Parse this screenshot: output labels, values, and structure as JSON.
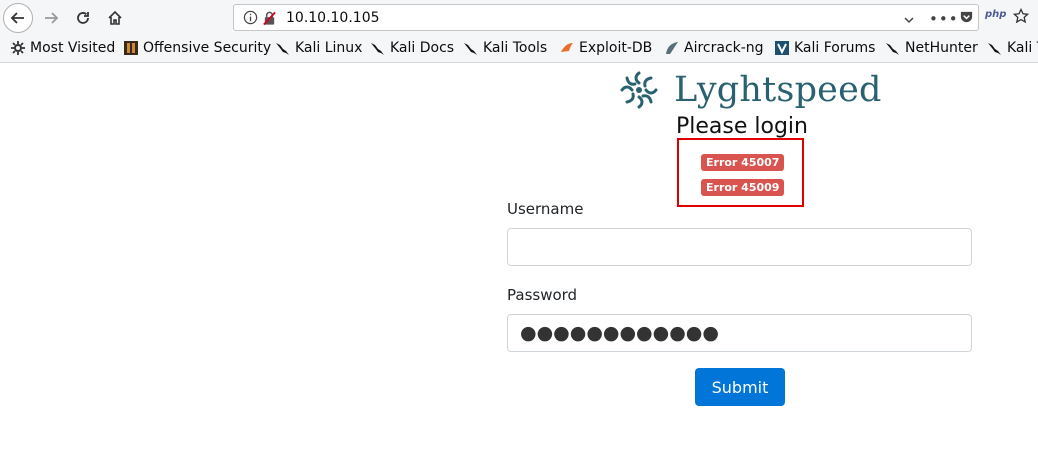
{
  "browser": {
    "url": "10.10.10.105",
    "bookmarks": [
      {
        "label": "Most Visited",
        "icon": "gear-icon"
      },
      {
        "label": "Offensive Security",
        "icon": "offsec-icon"
      },
      {
        "label": "Kali Linux",
        "icon": "kali-dragon-icon"
      },
      {
        "label": "Kali Docs",
        "icon": "kali-dragon-icon"
      },
      {
        "label": "Kali Tools",
        "icon": "kali-dragon-icon"
      },
      {
        "label": "Exploit-DB",
        "icon": "exploit-db-icon"
      },
      {
        "label": "Aircrack-ng",
        "icon": "aircrack-icon"
      },
      {
        "label": "Kali Forums",
        "icon": "kali-forums-icon"
      },
      {
        "label": "NetHunter",
        "icon": "kali-dragon-icon"
      },
      {
        "label": "Kali T",
        "icon": "kali-dragon-icon"
      }
    ]
  },
  "page": {
    "brand": "Lyghtspeed",
    "heading": "Please login",
    "errors": [
      "Error 45007",
      "Error 45009"
    ],
    "username_label": "Username",
    "username_value": "",
    "password_label": "Password",
    "password_value": "●●●●●●●●●●●●",
    "submit_label": "Submit"
  },
  "colors": {
    "brand": "#2a6170",
    "error_badge": "#d9534f",
    "highlight_box": "#e00000",
    "submit_button": "#0275d8"
  }
}
